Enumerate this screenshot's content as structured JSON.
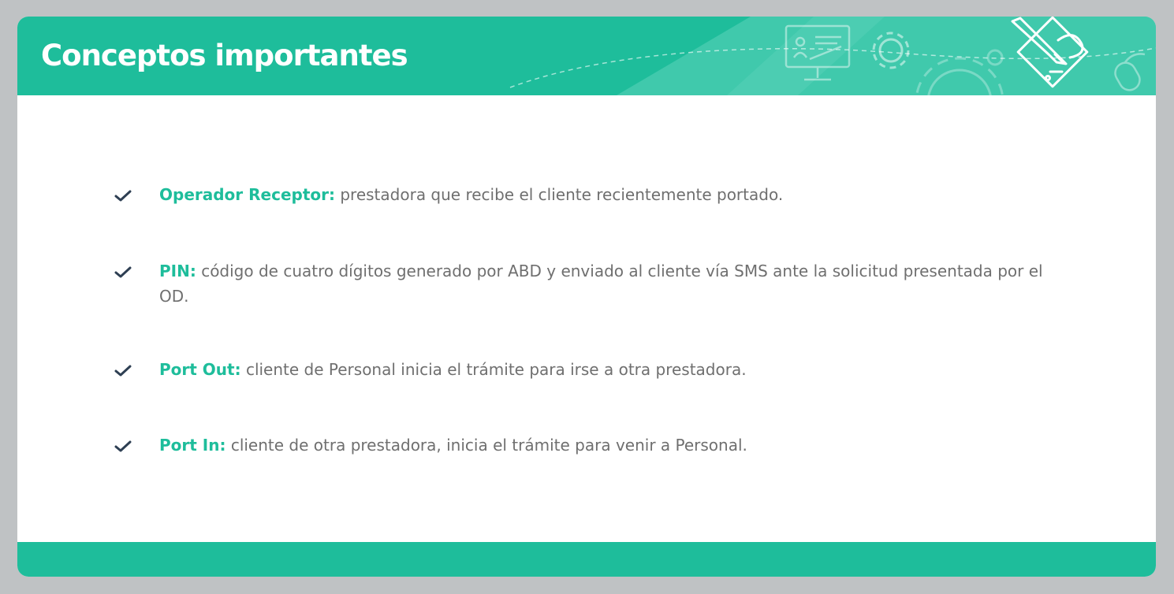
{
  "slide": {
    "title": "Conceptos importantes",
    "accent_color": "#1ebd9b",
    "text_color": "#6f6f6f",
    "check_color": "#2e3f53",
    "header_icons": [
      "monitor-icon",
      "gear-icon",
      "mouse-icon",
      "edit-document-icon"
    ]
  },
  "items": [
    {
      "term": "Operador Receptor:",
      "definition": " prestadora que recibe el cliente recientemente portado."
    },
    {
      "term": "PIN:",
      "definition": " código de cuatro dígitos generado por ABD y enviado al cliente vía SMS ante la solicitud presentada por el OD."
    },
    {
      "term": "Port Out:",
      "definition": " cliente de Personal inicia el trámite para irse a otra prestadora."
    },
    {
      "term": "Port In:",
      "definition": " cliente de otra prestadora, inicia el trámite para venir a Personal."
    }
  ]
}
